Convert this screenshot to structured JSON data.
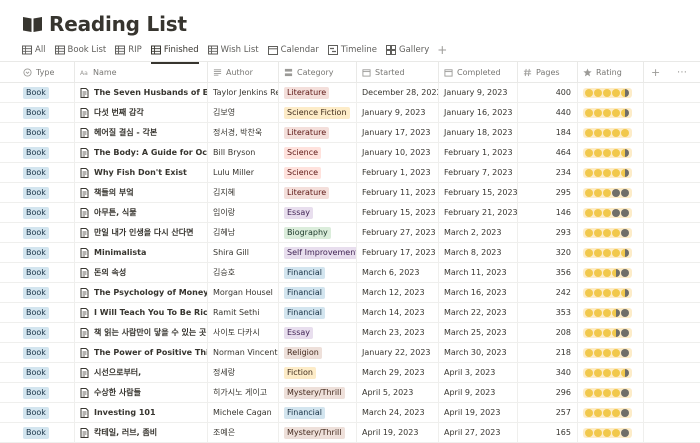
{
  "page": {
    "title": "Reading List"
  },
  "tabs": [
    {
      "label": "All",
      "icon": "table-icon"
    },
    {
      "label": "Book List",
      "icon": "table-icon"
    },
    {
      "label": "RIP",
      "icon": "table-icon"
    },
    {
      "label": "Finished",
      "icon": "table-icon",
      "active": true
    },
    {
      "label": "Wish List",
      "icon": "table-icon"
    },
    {
      "label": "Calendar",
      "icon": "calendar-icon"
    },
    {
      "label": "Timeline",
      "icon": "timeline-icon"
    },
    {
      "label": "Gallery",
      "icon": "gallery-icon"
    }
  ],
  "add_view_label": "+",
  "columns": {
    "type": "Type",
    "name": "Name",
    "author": "Author",
    "category": "Category",
    "started": "Started",
    "completed": "Completed",
    "pages": "Pages",
    "rating": "Rating"
  },
  "add_column_label": "+",
  "more_label": "⋯",
  "category_colors": {
    "Literature": {
      "bg": "#f4dfdb",
      "fg": "#5d1715"
    },
    "Science Fiction": {
      "bg": "#fdecc8",
      "fg": "#402c1b"
    },
    "Science": {
      "bg": "#ffe2dd",
      "fg": "#5d1715"
    },
    "Essay": {
      "bg": "#e8deee",
      "fg": "#412454"
    },
    "Biography": {
      "bg": "#dbeddb",
      "fg": "#1c3829"
    },
    "Self Improvement": {
      "bg": "#e8deee",
      "fg": "#412454"
    },
    "Financial": {
      "bg": "#d3e5ef",
      "fg": "#183347"
    },
    "Religion": {
      "bg": "#eee0da",
      "fg": "#442a1e"
    },
    "Fiction": {
      "bg": "#fdecc8",
      "fg": "#402c1b"
    },
    "Mystery/Thrill": {
      "bg": "#eee0da",
      "fg": "#442a1e"
    }
  },
  "rows": [
    {
      "type": "Book",
      "name": "The Seven Husbands of Evelyn Hugo",
      "author": "Taylor Jenkins Reid",
      "category": "Literature",
      "started": "December 28, 2022",
      "completed": "January 9, 2023",
      "pages": "400",
      "rating": 4.5
    },
    {
      "type": "Book",
      "name": "다섯 번째 감각",
      "author": "김보영",
      "category": "Science Fiction",
      "started": "January 9, 2023",
      "completed": "January 16, 2023",
      "pages": "440",
      "rating": 4.5
    },
    {
      "type": "Book",
      "name": "헤어질 결심 - 각본",
      "author": "정서경, 박찬욱",
      "category": "Literature",
      "started": "January 17, 2023",
      "completed": "January 18, 2023",
      "pages": "184",
      "rating": 5
    },
    {
      "type": "Book",
      "name": "The Body: A Guide for Occupants",
      "author": "Bill Bryson",
      "category": "Science",
      "started": "January 10, 2023",
      "completed": "February 1, 2023",
      "pages": "464",
      "rating": 4.5
    },
    {
      "type": "Book",
      "name": "Why Fish Don't Exist",
      "author": "Lulu Miller",
      "category": "Science",
      "started": "February 1, 2023",
      "completed": "February 7, 2023",
      "pages": "234",
      "rating": 4.5
    },
    {
      "type": "Book",
      "name": "책들의 부엌",
      "author": "김지혜",
      "category": "Literature",
      "started": "February 11, 2023",
      "completed": "February 15, 2023",
      "pages": "295",
      "rating": 3
    },
    {
      "type": "Book",
      "name": "아무튼, 식물",
      "author": "임이랑",
      "category": "Essay",
      "started": "February 15, 2023",
      "completed": "February 21, 2023",
      "pages": "146",
      "rating": 3
    },
    {
      "type": "Book",
      "name": "만일 내가 인생을 다시 산다면",
      "author": "김혜남",
      "category": "Biography",
      "started": "February 27, 2023",
      "completed": "March 2, 2023",
      "pages": "293",
      "rating": 4
    },
    {
      "type": "Book",
      "name": "Minimalista",
      "author": "Shira Gill",
      "category": "Self Improvement",
      "started": "February 17, 2023",
      "completed": "March 8, 2023",
      "pages": "320",
      "rating": 4.5
    },
    {
      "type": "Book",
      "name": "돈의 속성",
      "author": "김승호",
      "category": "Financial",
      "started": "March 6, 2023",
      "completed": "March 11, 2023",
      "pages": "356",
      "rating": 3.5
    },
    {
      "type": "Book",
      "name": "The Psychology of Money",
      "author": "Morgan Housel",
      "category": "Financial",
      "started": "March 12, 2023",
      "completed": "March 16, 2023",
      "pages": "242",
      "rating": 4.5
    },
    {
      "type": "Book",
      "name": "I Will Teach You To Be Rich",
      "author": "Ramit Sethi",
      "category": "Financial",
      "started": "March 14, 2023",
      "completed": "March 22, 2023",
      "pages": "353",
      "rating": 3.5
    },
    {
      "type": "Book",
      "name": "책 읽는 사람만이 닿을 수 있는 곳",
      "author": "사이토 다카시",
      "category": "Essay",
      "started": "March 23, 2023",
      "completed": "March 25, 2023",
      "pages": "208",
      "rating": 3.5
    },
    {
      "type": "Book",
      "name": "The Power of Positive Thinking",
      "author": "Norman Vincent Peale",
      "category": "Religion",
      "started": "January 22, 2023",
      "completed": "March 30, 2023",
      "pages": "218",
      "rating": 4
    },
    {
      "type": "Book",
      "name": "시선으로부터,",
      "author": "정세랑",
      "category": "Fiction",
      "started": "March 29, 2023",
      "completed": "April 3, 2023",
      "pages": "340",
      "rating": 4.5
    },
    {
      "type": "Book",
      "name": "수상한 사람들",
      "author": "히가시노 게이고",
      "category": "Mystery/Thrill",
      "started": "April 5, 2023",
      "completed": "April 9, 2023",
      "pages": "296",
      "rating": 4
    },
    {
      "type": "Book",
      "name": "Investing 101",
      "author": "Michele Cagan",
      "category": "Financial",
      "started": "March 24, 2023",
      "completed": "April 19, 2023",
      "pages": "257",
      "rating": 4
    },
    {
      "type": "Book",
      "name": "칵테일, 러브, 좀비",
      "author": "조예은",
      "category": "Mystery/Thrill",
      "started": "April 19, 2023",
      "completed": "April 27, 2023",
      "pages": "165",
      "rating": 4
    }
  ]
}
